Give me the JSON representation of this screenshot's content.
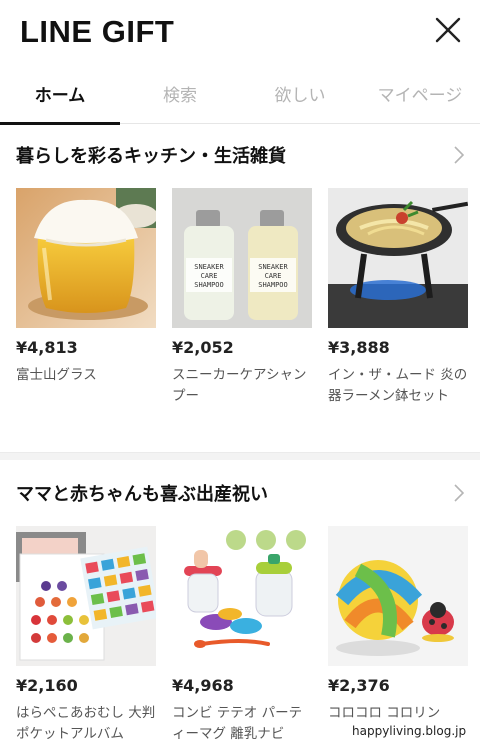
{
  "header": {
    "logo_text": "LINE GIFT",
    "close_icon": "close-icon"
  },
  "tabs": [
    {
      "label": "ホーム",
      "active": true
    },
    {
      "label": "検索",
      "active": false
    },
    {
      "label": "欲しい",
      "active": false
    },
    {
      "label": "マイページ",
      "active": false
    }
  ],
  "sections": [
    {
      "title": "暮らしを彩るキッチン・生活雑貨",
      "items": [
        {
          "price": "¥4,813",
          "name": "富士山グラス"
        },
        {
          "price": "¥2,052",
          "name": "スニーカーケアシャンプー",
          "product_label": [
            "SNEAKER",
            "CARE",
            "SHAMPOO"
          ]
        },
        {
          "price": "¥3,888",
          "name": "イン・ザ・ムード 炎の器ラーメン鉢セット"
        }
      ]
    },
    {
      "title": "ママと赤ちゃんも喜ぶ出産祝い",
      "items": [
        {
          "price": "¥2,160",
          "name": "はらぺこあおむし 大判ポケットアルバム"
        },
        {
          "price": "¥4,968",
          "name": "コンビ テテオ パーティーマグ 離乳ナビ"
        },
        {
          "price": "¥2,376",
          "name": "コロコロ コロリン"
        }
      ]
    }
  ],
  "watermark": "happyliving.blog.jp"
}
